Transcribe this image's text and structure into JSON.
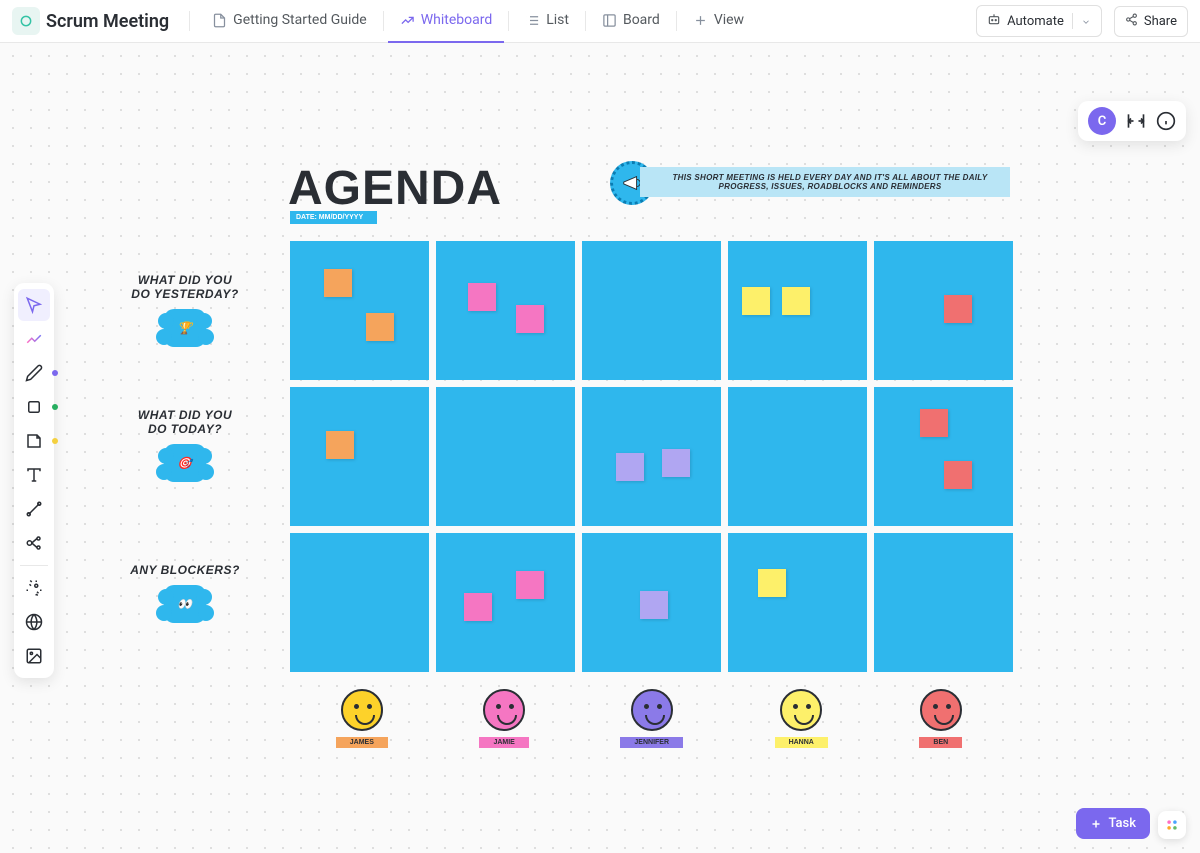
{
  "header": {
    "title": "Scrum Meeting",
    "tabs": [
      {
        "label": "Getting Started Guide",
        "icon": "doc"
      },
      {
        "label": "Whiteboard",
        "icon": "whiteboard",
        "active": true
      },
      {
        "label": "List",
        "icon": "list"
      },
      {
        "label": "Board",
        "icon": "board"
      },
      {
        "label": "View",
        "icon": "plus"
      }
    ],
    "automate_label": "Automate",
    "share_label": "Share",
    "avatar_initial": "C"
  },
  "whiteboard": {
    "agenda_title": "AGENDA",
    "date_label": "DATE: MM/DD/YYYY",
    "description": "THIS SHORT MEETING IS HELD EVERY DAY AND IT'S ALL ABOUT THE DAILY PROGRESS, ISSUES, ROADBLOCKS AND REMINDERS",
    "rows": [
      {
        "label_line1": "WHAT DID YOU",
        "label_line2": "DO YESTERDAY?",
        "icon": "trophy"
      },
      {
        "label_line1": "WHAT DID YOU",
        "label_line2": "DO TODAY?",
        "icon": "target"
      },
      {
        "label_line1": "ANY BLOCKERS?",
        "label_line2": "",
        "icon": "eyes"
      }
    ],
    "people": [
      {
        "name": "JAMES",
        "face_color": "#fdd22a",
        "tag_color": "#f5a45c"
      },
      {
        "name": "JAMIE",
        "face_color": "#f576c2",
        "tag_color": "#f576c2"
      },
      {
        "name": "JENNIFER",
        "face_color": "#8b7ae8",
        "tag_color": "#8b7ae8"
      },
      {
        "name": "HANNA",
        "face_color": "#fdf06a",
        "tag_color": "#fdf06a"
      },
      {
        "name": "BEN",
        "face_color": "#f07070",
        "tag_color": "#f07070"
      }
    ],
    "stickies": {
      "row0": [
        {
          "col": 0,
          "notes": [
            {
              "x": 34,
              "y": 28,
              "c": "#f5a45c"
            },
            {
              "x": 76,
              "y": 72,
              "c": "#f5a45c"
            }
          ]
        },
        {
          "col": 1,
          "notes": [
            {
              "x": 32,
              "y": 42,
              "c": "#f576c2"
            },
            {
              "x": 80,
              "y": 64,
              "c": "#f576c2"
            }
          ]
        },
        {
          "col": 2,
          "notes": []
        },
        {
          "col": 3,
          "notes": [
            {
              "x": 14,
              "y": 46,
              "c": "#fdf06a"
            },
            {
              "x": 54,
              "y": 46,
              "c": "#fdf06a"
            }
          ]
        },
        {
          "col": 4,
          "notes": [
            {
              "x": 70,
              "y": 54,
              "c": "#f07070"
            }
          ]
        }
      ],
      "row1": [
        {
          "col": 0,
          "notes": [
            {
              "x": 36,
              "y": 44,
              "c": "#f5a45c"
            }
          ]
        },
        {
          "col": 1,
          "notes": []
        },
        {
          "col": 2,
          "notes": [
            {
              "x": 34,
              "y": 66,
              "c": "#b0a6f2"
            },
            {
              "x": 80,
              "y": 62,
              "c": "#b0a6f2"
            }
          ]
        },
        {
          "col": 3,
          "notes": []
        },
        {
          "col": 4,
          "notes": [
            {
              "x": 46,
              "y": 22,
              "c": "#f07070"
            },
            {
              "x": 70,
              "y": 74,
              "c": "#f07070"
            }
          ]
        }
      ],
      "row2": [
        {
          "col": 0,
          "notes": []
        },
        {
          "col": 1,
          "notes": [
            {
              "x": 28,
              "y": 60,
              "c": "#f576c2"
            },
            {
              "x": 80,
              "y": 38,
              "c": "#f576c2"
            }
          ]
        },
        {
          "col": 2,
          "notes": [
            {
              "x": 58,
              "y": 58,
              "c": "#b0a6f2"
            }
          ]
        },
        {
          "col": 3,
          "notes": [
            {
              "x": 30,
              "y": 36,
              "c": "#fdf06a"
            }
          ]
        },
        {
          "col": 4,
          "notes": []
        }
      ]
    }
  },
  "footer": {
    "task_label": "Task"
  },
  "colors": {
    "primary": "#7b68ee",
    "board_blue": "#2fb7ed"
  }
}
